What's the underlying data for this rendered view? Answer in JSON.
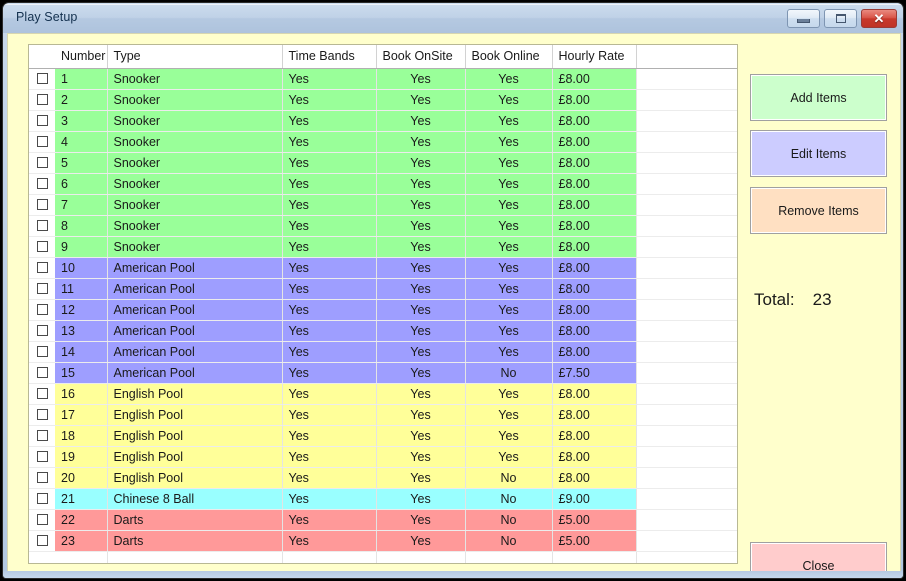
{
  "window": {
    "title": "Play Setup",
    "controls": [
      {
        "name": "minimize",
        "glyph": "minimize-icon",
        "label": ""
      },
      {
        "name": "maximize",
        "glyph": "maximize-icon",
        "label": ""
      },
      {
        "name": "close",
        "glyph": "close-icon",
        "label": "✕"
      }
    ]
  },
  "grid": {
    "columns": [
      "Number",
      "Type",
      "Time Bands",
      "Book OnSite",
      "Book Online",
      "Hourly Rate"
    ],
    "rows": [
      {
        "number": "1",
        "type": "Snooker",
        "time_bands": "Yes",
        "book_onsite": "Yes",
        "book_online": "Yes",
        "hourly_rate": "£8.00",
        "color": "#99ff99",
        "checked": false
      },
      {
        "number": "2",
        "type": "Snooker",
        "time_bands": "Yes",
        "book_onsite": "Yes",
        "book_online": "Yes",
        "hourly_rate": "£8.00",
        "color": "#99ff99",
        "checked": false
      },
      {
        "number": "3",
        "type": "Snooker",
        "time_bands": "Yes",
        "book_onsite": "Yes",
        "book_online": "Yes",
        "hourly_rate": "£8.00",
        "color": "#99ff99",
        "checked": false
      },
      {
        "number": "4",
        "type": "Snooker",
        "time_bands": "Yes",
        "book_onsite": "Yes",
        "book_online": "Yes",
        "hourly_rate": "£8.00",
        "color": "#99ff99",
        "checked": false
      },
      {
        "number": "5",
        "type": "Snooker",
        "time_bands": "Yes",
        "book_onsite": "Yes",
        "book_online": "Yes",
        "hourly_rate": "£8.00",
        "color": "#99ff99",
        "checked": false
      },
      {
        "number": "6",
        "type": "Snooker",
        "time_bands": "Yes",
        "book_onsite": "Yes",
        "book_online": "Yes",
        "hourly_rate": "£8.00",
        "color": "#99ff99",
        "checked": false
      },
      {
        "number": "7",
        "type": "Snooker",
        "time_bands": "Yes",
        "book_onsite": "Yes",
        "book_online": "Yes",
        "hourly_rate": "£8.00",
        "color": "#99ff99",
        "checked": false
      },
      {
        "number": "8",
        "type": "Snooker",
        "time_bands": "Yes",
        "book_onsite": "Yes",
        "book_online": "Yes",
        "hourly_rate": "£8.00",
        "color": "#99ff99",
        "checked": false
      },
      {
        "number": "9",
        "type": "Snooker",
        "time_bands": "Yes",
        "book_onsite": "Yes",
        "book_online": "Yes",
        "hourly_rate": "£8.00",
        "color": "#99ff99",
        "checked": false
      },
      {
        "number": "10",
        "type": "American Pool",
        "time_bands": "Yes",
        "book_onsite": "Yes",
        "book_online": "Yes",
        "hourly_rate": "£8.00",
        "color": "#9e9eff",
        "checked": false
      },
      {
        "number": "11",
        "type": "American Pool",
        "time_bands": "Yes",
        "book_onsite": "Yes",
        "book_online": "Yes",
        "hourly_rate": "£8.00",
        "color": "#9e9eff",
        "checked": false
      },
      {
        "number": "12",
        "type": "American Pool",
        "time_bands": "Yes",
        "book_onsite": "Yes",
        "book_online": "Yes",
        "hourly_rate": "£8.00",
        "color": "#9e9eff",
        "checked": false
      },
      {
        "number": "13",
        "type": "American Pool",
        "time_bands": "Yes",
        "book_onsite": "Yes",
        "book_online": "Yes",
        "hourly_rate": "£8.00",
        "color": "#9e9eff",
        "checked": false
      },
      {
        "number": "14",
        "type": "American Pool",
        "time_bands": "Yes",
        "book_onsite": "Yes",
        "book_online": "Yes",
        "hourly_rate": "£8.00",
        "color": "#9e9eff",
        "checked": false
      },
      {
        "number": "15",
        "type": "American Pool",
        "time_bands": "Yes",
        "book_onsite": "Yes",
        "book_online": "No",
        "hourly_rate": "£7.50",
        "color": "#9e9eff",
        "checked": false
      },
      {
        "number": "16",
        "type": "English Pool",
        "time_bands": "Yes",
        "book_onsite": "Yes",
        "book_online": "Yes",
        "hourly_rate": "£8.00",
        "color": "#ffff99",
        "checked": false
      },
      {
        "number": "17",
        "type": "English Pool",
        "time_bands": "Yes",
        "book_onsite": "Yes",
        "book_online": "Yes",
        "hourly_rate": "£8.00",
        "color": "#ffff99",
        "checked": false
      },
      {
        "number": "18",
        "type": "English Pool",
        "time_bands": "Yes",
        "book_onsite": "Yes",
        "book_online": "Yes",
        "hourly_rate": "£8.00",
        "color": "#ffff99",
        "checked": false
      },
      {
        "number": "19",
        "type": "English Pool",
        "time_bands": "Yes",
        "book_onsite": "Yes",
        "book_online": "Yes",
        "hourly_rate": "£8.00",
        "color": "#ffff99",
        "checked": false
      },
      {
        "number": "20",
        "type": "English Pool",
        "time_bands": "Yes",
        "book_onsite": "Yes",
        "book_online": "No",
        "hourly_rate": "£8.00",
        "color": "#ffff99",
        "checked": false
      },
      {
        "number": "21",
        "type": "Chinese 8 Ball",
        "time_bands": "Yes",
        "book_onsite": "Yes",
        "book_online": "No",
        "hourly_rate": "£9.00",
        "color": "#99ffff",
        "checked": false
      },
      {
        "number": "22",
        "type": "Darts",
        "time_bands": "Yes",
        "book_onsite": "Yes",
        "book_online": "No",
        "hourly_rate": "£5.00",
        "color": "#ff9999",
        "checked": false
      },
      {
        "number": "23",
        "type": "Darts",
        "time_bands": "Yes",
        "book_onsite": "Yes",
        "book_online": "No",
        "hourly_rate": "£5.00",
        "color": "#ff9999",
        "checked": false
      }
    ]
  },
  "side_panel": {
    "add_items_label": "Add Items",
    "edit_items_label": "Edit Items",
    "remove_items_label": "Remove Items",
    "close_label": "Close",
    "total_label": "Total:",
    "total_value": "23",
    "colors": {
      "add": "#ccffcc",
      "edit": "#ccccff",
      "remove": "#ffe0c2",
      "close": "#ffcccc",
      "panel_background": "#ffffcc"
    }
  }
}
